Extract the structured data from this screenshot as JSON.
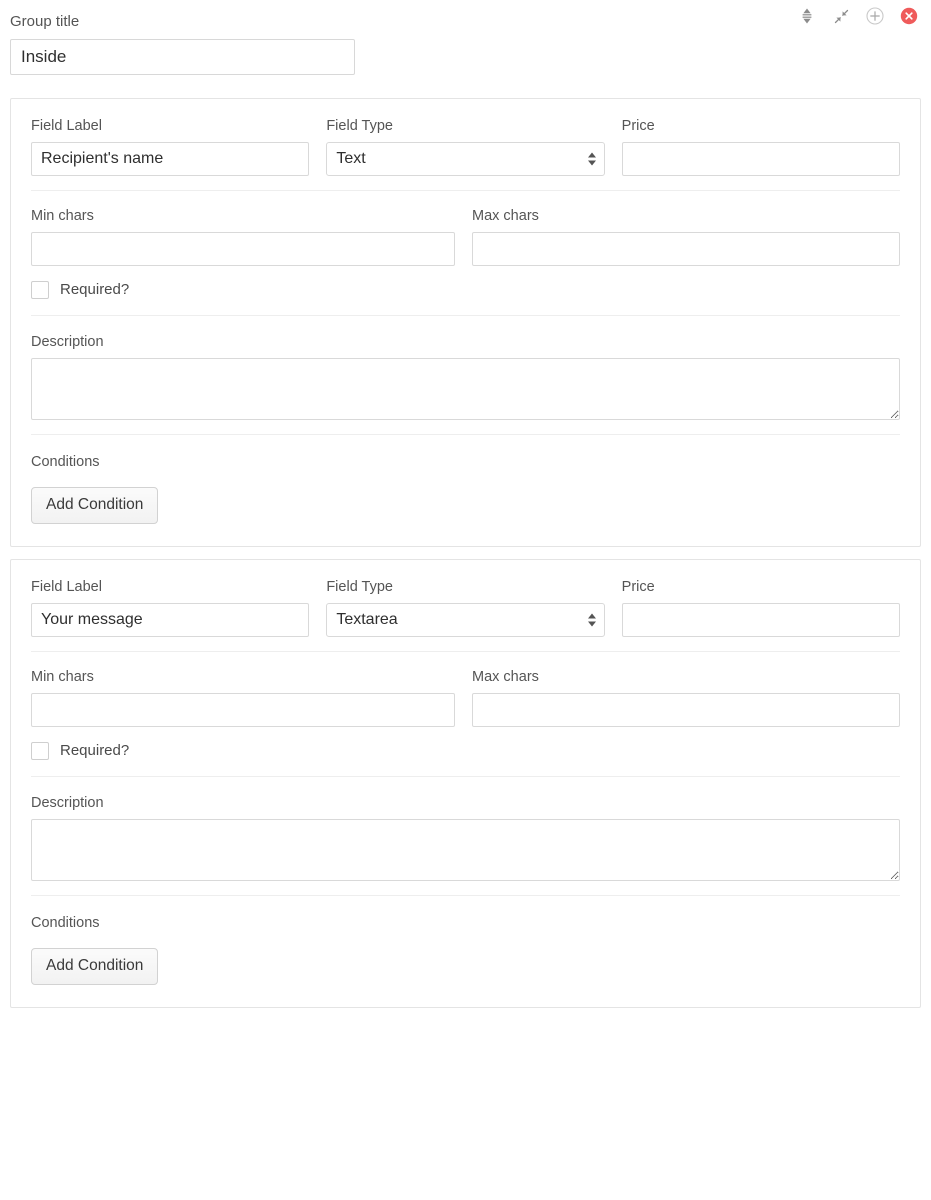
{
  "group": {
    "title_label": "Group title",
    "title_value": "Inside",
    "title_placeholder": ""
  },
  "header_actions": [
    {
      "name": "reorder-icon",
      "title": "Reorder group"
    },
    {
      "name": "collapse-icon",
      "title": "Collapse group"
    },
    {
      "name": "add-circle-icon",
      "title": "Add field"
    },
    {
      "name": "remove-circle-icon",
      "title": "Remove group",
      "color": "#ef5b5b"
    }
  ],
  "labels": {
    "field_label": "Field Label",
    "field_type": "Field Type",
    "price": "Price",
    "min_chars": "Min chars",
    "max_chars": "Max chars",
    "required": "Required?",
    "description": "Description",
    "conditions": "Conditions",
    "add_condition": "Add Condition"
  },
  "field_type_options": [
    "Text",
    "Textarea"
  ],
  "fields": [
    {
      "label_value": "Recipient's name",
      "label_placeholder": "",
      "type_value": "Text",
      "price_value": "",
      "price_placeholder": "",
      "min_chars_value": "",
      "min_chars_placeholder": "",
      "max_chars_value": "",
      "max_chars_placeholder": "",
      "required_checked": false,
      "description_value": "",
      "description_placeholder": "",
      "add_condition_label": "Add Condition"
    },
    {
      "label_value": "Your message",
      "label_placeholder": "",
      "type_value": "Textarea",
      "price_value": "",
      "price_placeholder": "",
      "min_chars_value": "",
      "min_chars_placeholder": "",
      "max_chars_value": "",
      "max_chars_placeholder": "",
      "required_checked": false,
      "description_value": "",
      "description_placeholder": "",
      "add_condition_label": "Add Condition"
    }
  ],
  "colors": {
    "panel_border": "#e4e4e4",
    "input_border": "#d9d9d9",
    "divider": "#eeeeee",
    "text": "#555555",
    "danger": "#ef5b5b"
  }
}
